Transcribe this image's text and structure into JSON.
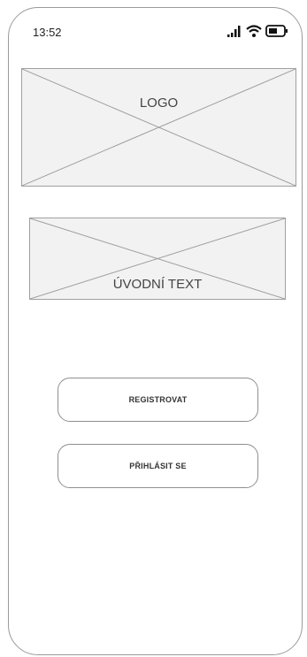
{
  "status_bar": {
    "time": "13:52",
    "icons": [
      "signal-icon",
      "wifi-icon",
      "battery-icon"
    ]
  },
  "logo_placeholder": {
    "label": "LOGO"
  },
  "intro_placeholder": {
    "label": "ÚVODNÍ TEXT"
  },
  "actions": {
    "register_label": "REGISTROVAT",
    "login_label": "PŘIHLÁSIT SE"
  }
}
